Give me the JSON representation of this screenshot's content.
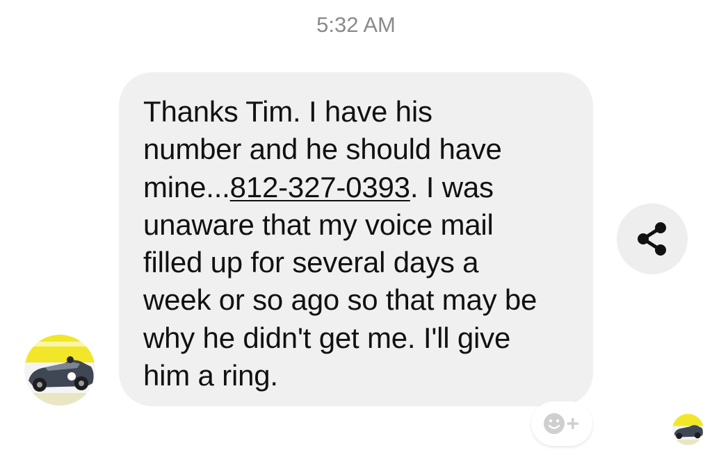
{
  "timestamp": "5:32 AM",
  "message": {
    "lines": [
      "Thanks Tim. I have his",
      "number and he should have",
      "unaware that my voice mail",
      "filled up for several days a",
      "week or so ago so that may be",
      "why he didn't get me. I'll give",
      "him a ring."
    ],
    "line3_prefix": "mine...",
    "phone_number": "812-327-0393",
    "line3_suffix": ". I was"
  },
  "icons": {
    "share": "share-icon",
    "reaction": "add-reaction-icon",
    "avatar": "avatar-car-photo"
  },
  "colors": {
    "bubble": "#f0f0f0",
    "timestamp": "#8a8a8a",
    "icon_gray": "#cfcfcf",
    "avatar_yellow": "#f2e629"
  }
}
